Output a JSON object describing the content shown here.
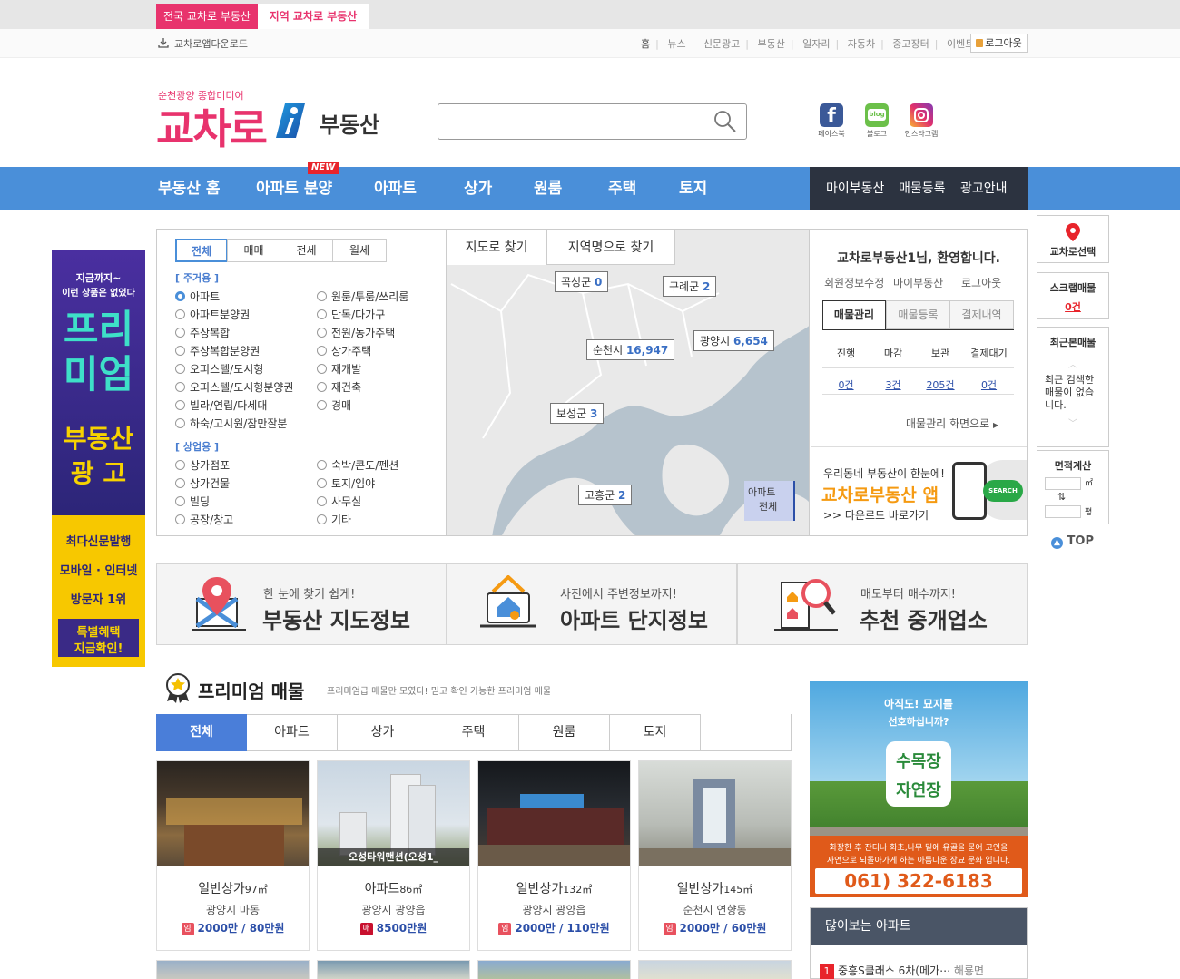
{
  "site_tabs": [
    "전국 교차로 부동산",
    "지역 교차로 부동산"
  ],
  "util": {
    "app_download": "교차로앱다운로드",
    "nav": [
      "홈",
      "뉴스",
      "신문광고",
      "부동산",
      "일자리",
      "자동차",
      "중고장터",
      "이벤트"
    ],
    "logout": "로그아웃"
  },
  "header": {
    "tagline": "순천광양 종합미디어",
    "logo": "교차로",
    "logo_sub": "부동산",
    "search_placeholder": "",
    "sns": [
      "페이스북",
      "블로그",
      "인스타그램"
    ]
  },
  "main_nav": {
    "items": [
      "부동산 홈",
      "아파트 분양",
      "아파트",
      "상가",
      "원룸",
      "주택",
      "토지"
    ],
    "new_badge": "NEW",
    "my_items": [
      "마이부동산",
      "매물등록",
      "광고안내"
    ]
  },
  "left_ad": {
    "line1": "지금까지~",
    "line2": "이런 상품은 없었다",
    "big1": "프리",
    "big2": "미엄",
    "sub1": "부동산",
    "sub2": "광 고",
    "info": [
      "최다신문발행",
      "모바일 · 인터넷",
      "방문자 1위"
    ],
    "cta1": "특별혜택",
    "cta2": "지금확인!"
  },
  "deal_tabs": [
    "전체",
    "매매",
    "전세",
    "월세"
  ],
  "residential": {
    "label": "[ 주거용 ]",
    "left": [
      "아파트",
      "아파트분양권",
      "주상복합",
      "주상복합분양권",
      "오피스텔/도시형",
      "오피스텔/도시형분양권",
      "빌라/연립/다세대",
      "하숙/고시원/잠만잘분"
    ],
    "right": [
      "원룸/투룸/쓰리룸",
      "단독/다가구",
      "전원/농가주택",
      "상가주택",
      "재개발",
      "재건축",
      "경매"
    ]
  },
  "commercial": {
    "label": "[ 상업용 ]",
    "left": [
      "상가점포",
      "상가건물",
      "빌딩",
      "공장/창고"
    ],
    "right": [
      "숙박/콘도/펜션",
      "토지/임야",
      "사무실",
      "기타"
    ]
  },
  "map": {
    "tabs": [
      "지도로 찾기",
      "지역명으로 찾기"
    ],
    "regions": [
      {
        "name": "곡성군",
        "count": "0"
      },
      {
        "name": "구례군",
        "count": "2"
      },
      {
        "name": "광양시",
        "count": "6,654"
      },
      {
        "name": "순천시",
        "count": "16,947"
      },
      {
        "name": "보성군",
        "count": "3"
      },
      {
        "name": "고흥군",
        "count": "2"
      }
    ],
    "filter1": "아파트",
    "filter2": "전체"
  },
  "member": {
    "welcome": "교차로부동산1님, 환영합니다.",
    "links": [
      "회원정보수정",
      "마이부동산",
      "로그아웃"
    ],
    "tabs": [
      "매물관리",
      "매물등록",
      "결제내역"
    ],
    "stat_headers": [
      "진행",
      "마감",
      "보관",
      "결제대기"
    ],
    "stat_values": [
      "0건",
      "3건",
      "205건",
      "0건"
    ],
    "manage_link": "매물관리 화면으로",
    "app_line1": "우리동네 부동산이 한눈에!",
    "app_title": "교차로부동산 앱",
    "app_line3": ">> 다운로드 바로가기",
    "app_search": "SEARCH"
  },
  "quick": {
    "select": "교차로선택",
    "scrap_label": "스크랩매물",
    "scrap_count": "0건",
    "recent_label": "최근본매물",
    "recent_empty": "최근 검색한 매물이 없습니다.",
    "area_label": "면적계산",
    "unit_m2": "㎡",
    "unit_py": "평",
    "top": "TOP"
  },
  "features": [
    {
      "sub": "한 눈에 찾기 쉽게!",
      "title": "부동산 지도정보"
    },
    {
      "sub": "사진에서 주변정보까지!",
      "title": "아파트 단지정보"
    },
    {
      "sub": "매도부터 매수까지!",
      "title": "추천 중개업소"
    }
  ],
  "premium": {
    "title": "프리미엄 매물",
    "subtitle": "프리미엄급 매물만 모였다! 믿고 확인 가능한 프리미엄 매물",
    "tabs": [
      "전체",
      "아파트",
      "상가",
      "주택",
      "원룸",
      "토지"
    ],
    "cards": [
      {
        "type": "일반상가",
        "area": "97㎡",
        "location": "광양시 마동",
        "badge": "임",
        "price": "2000만 / 80만원",
        "caption": ""
      },
      {
        "type": "아파트",
        "area": "86㎡",
        "location": "광양시 광양읍",
        "badge": "매",
        "price": "8500만원",
        "caption": "오성타워맨션(오성1_"
      },
      {
        "type": "일반상가",
        "area": "132㎡",
        "location": "광양시 광양읍",
        "badge": "임",
        "price": "2000만 / 110만원",
        "caption": ""
      },
      {
        "type": "일반상가",
        "area": "145㎡",
        "location": "순천시 연향동",
        "badge": "임",
        "price": "2000만 / 60만원",
        "caption": ""
      }
    ]
  },
  "right_ad": {
    "line1": "아직도! 묘지를",
    "line2": "선호하십니까?",
    "badge1": "수목장",
    "badge2": "자연장",
    "desc1": "화장한 후 잔디나 화초,나무 밑에 유골을 묻어 고인을",
    "desc2": "자연으로 되돌아가게 하는 아름다운 장묘 문화 입니다.",
    "phone": "061) 322-6183"
  },
  "popular": {
    "title": "많이보는 아파트",
    "items": [
      {
        "rank": "1",
        "name": "중흥S클래스 6차(메가⋯",
        "loc": "해룡면"
      }
    ]
  }
}
